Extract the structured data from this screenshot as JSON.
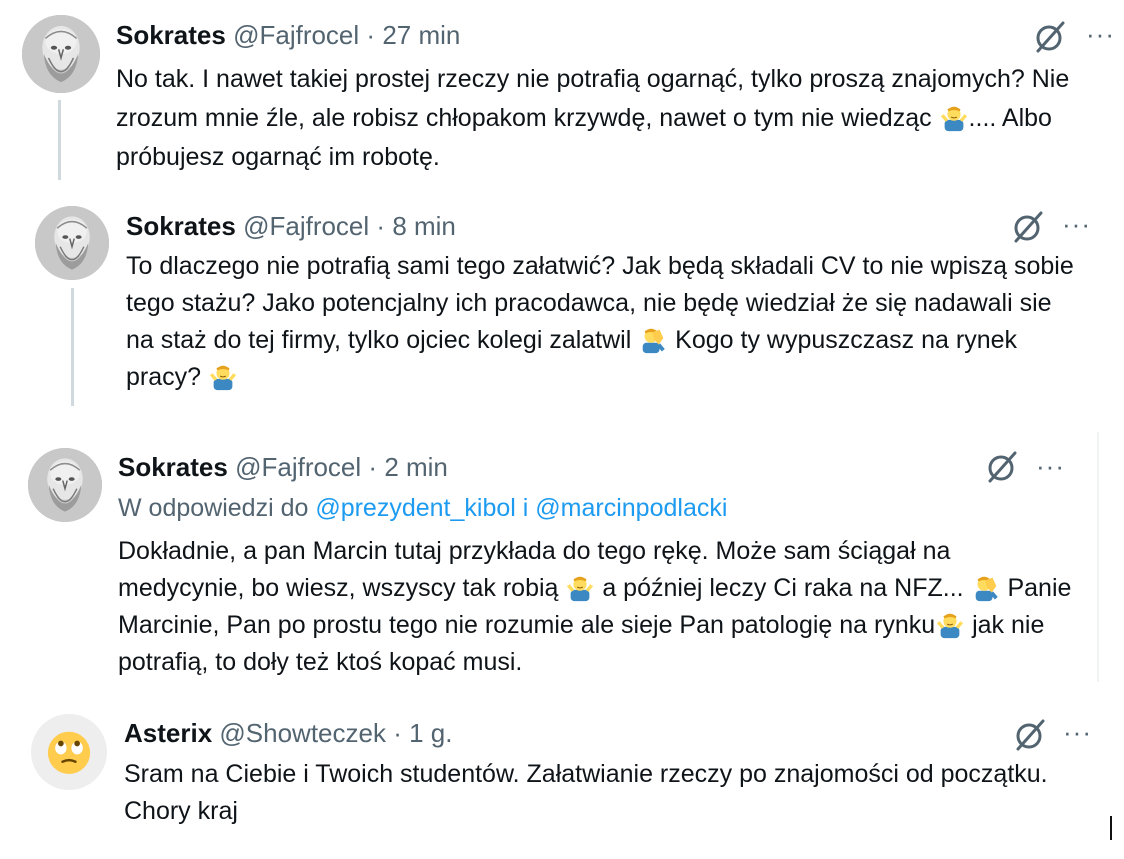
{
  "tweets": [
    {
      "name": "Sokrates",
      "handle": "@Fajfrocel",
      "separator": "·",
      "time": "27 min",
      "text_a": "No tak. I nawet takiej prostej rzeczy nie potrafią ogarnąć, tylko proszą znajomych? Nie zrozum mnie źle, ale robisz chłopakom krzywdę, nawet o tym nie wiedząc ",
      "text_b": ".... Albo próbujesz ogarnąć im robotę."
    },
    {
      "name": "Sokrates",
      "handle": "@Fajfrocel",
      "separator": "·",
      "time": "8 min",
      "text_a": "To dlaczego nie potrafią sami tego załatwić? Jak będą składali CV to nie wpiszą sobie tego stażu? Jako potencjalny ich pracodawca, nie będę wiedział że się nadawali sie na staż do tej firmy, tylko ojciec kolegi zalatwil ",
      "text_b": " Kogo ty wypuszczasz na rynek pracy? "
    },
    {
      "name": "Sokrates",
      "handle": "@Fajfrocel",
      "separator": "·",
      "time": "2 min",
      "reply_prefix": "W odpowiedzi do ",
      "reply_user1": "@prezydent_kibol",
      "reply_and": " i ",
      "reply_user2": "@marcinpodlacki",
      "text_a": "Dokładnie, a pan Marcin tutaj przykłada do tego rękę. Może sam ściągał na medycynie, bo wiesz, wszyscy tak robią ",
      "text_b": " a później leczy Ci raka na NFZ... ",
      "text_c": " Panie Marcinie, Pan po prostu tego nie rozumie ale sieje Pan patologię na rynku",
      "text_d": " jak nie potrafią, to doły też ktoś kopać musi."
    },
    {
      "name": "Asterix",
      "handle": "@Showteczek",
      "separator": "·",
      "time": "1 g.",
      "text_a": "Sram na Ciebie i Twoich studentów. Załatwianie rzeczy po znajomości od początku. Chory kraj"
    }
  ],
  "icons": {
    "grok": "grok-icon",
    "more": "more-icon",
    "more_glyph": "···",
    "shrug": "person-shrugging-emoji",
    "facepalm": "person-facepalming-emoji",
    "eyeroll": "face-with-rolling-eyes-emoji"
  },
  "colors": {
    "text": "#0f1419",
    "secondary": "#536471",
    "link": "#1d9bf0",
    "thread_line": "#cfd9de"
  }
}
